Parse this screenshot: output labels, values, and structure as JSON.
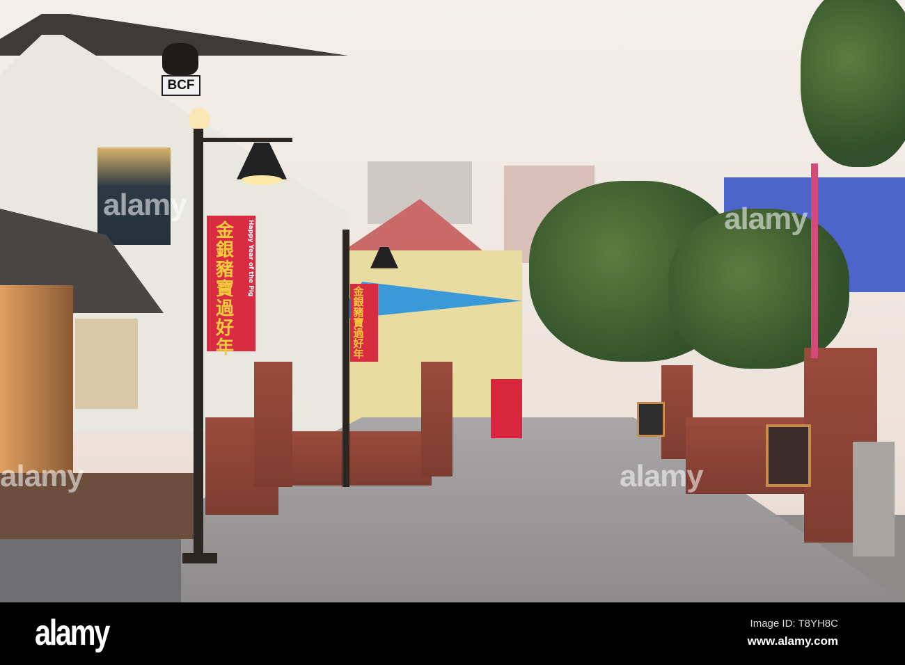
{
  "photo": {
    "sign_text": "BCF",
    "banner_text": "金銀豬寶過好年",
    "banner_subtext": "Happy Year of the Pig",
    "watermark": "alamy"
  },
  "footer": {
    "logo": "alamy",
    "image_id": "Image ID: T8YH8C",
    "url": "www.alamy.com"
  },
  "colors": {
    "banner": "#d92c43",
    "brick": "#8a4436",
    "footer": "#000000"
  }
}
